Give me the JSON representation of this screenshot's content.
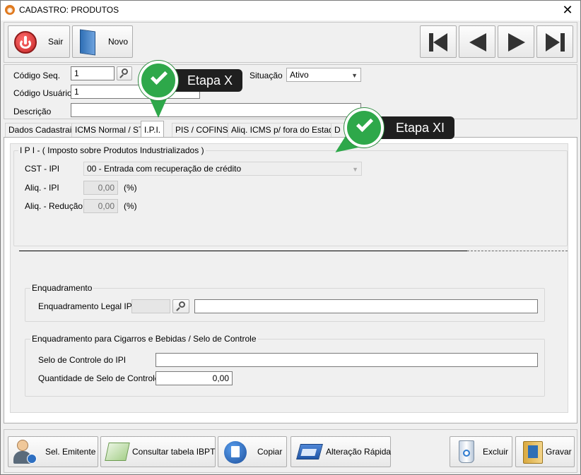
{
  "window": {
    "title": "CADASTRO: PRODUTOS",
    "close_glyph": "✕"
  },
  "toolbar": {
    "exit_label": "Sair",
    "new_label": "Novo"
  },
  "header": {
    "code_seq_label": "Código Seq.",
    "code_seq_value": "1",
    "status_label": "Situação",
    "status_value": "Ativo",
    "user_code_label": "Código Usuário",
    "user_code_value": "1",
    "description_label": "Descrição",
    "description_value": ""
  },
  "tabs": [
    "Dados Cadastrais",
    "ICMS Normal / ST",
    "I.P.I.",
    "PIS / COFINS",
    "Aliq. ICMS p/ fora do Estado",
    "D"
  ],
  "callouts": {
    "step_x": "Etapa X",
    "step_xi": "Etapa XI"
  },
  "ipi": {
    "group_title": "I P I - ( Imposto sobre Produtos Industrializados )",
    "cst_label": "CST - IPI",
    "cst_value": "00 - Entrada com recuperação de crédito",
    "aliq_label": "Aliq. - IPI",
    "aliq_value": "0,00",
    "aliq_unit": "(%)",
    "aliq_red_label": "Aliq. - Redução",
    "aliq_red_value": "0,00",
    "aliq_red_unit": "(%)"
  },
  "enquadramento": {
    "group_title": "Enquadramento",
    "legal_label": "Enquadramento Legal IPI",
    "legal_code": "",
    "legal_desc": ""
  },
  "selo": {
    "group_title": "Enquadramento para Cigarros e Bebidas / Selo de Controle",
    "selo_label": "Selo de Controle do IPI",
    "selo_value": "",
    "qty_label": "Quantidade de Selo de Controle",
    "qty_value": "0,00"
  },
  "footer": {
    "sel_emitente": "Sel. Emitente",
    "consultar_ibpt": "Consultar tabela IBPT",
    "copiar": "Copiar",
    "alteracao_rapida": "Alteração Rápida",
    "excluir": "Excluir",
    "gravar": "Gravar"
  },
  "colors": {
    "accent_green": "#2ea84a",
    "callout_bg": "#1f1f1f",
    "power_red": "#d32f2f"
  }
}
